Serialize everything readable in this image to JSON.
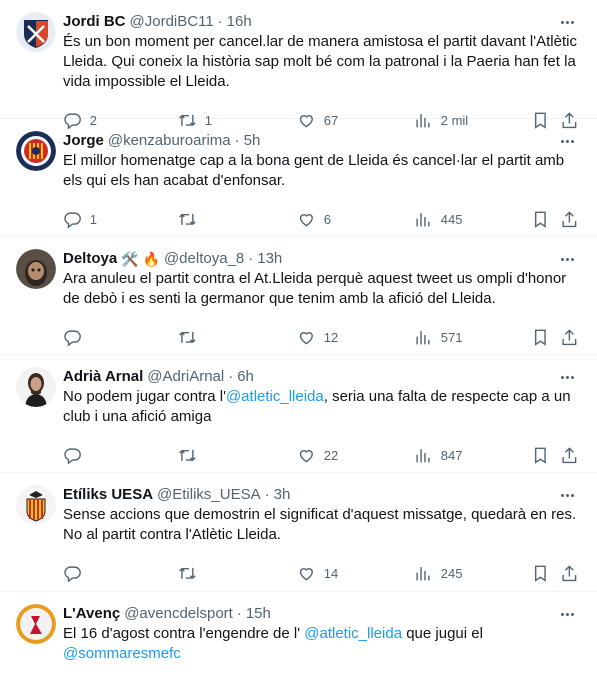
{
  "tweets": [
    {
      "name": "Jordi BC",
      "emoji": "",
      "handle": "@JordiBC11",
      "time": "16h",
      "text_parts": [
        {
          "t": "És un bon moment per cancel.lar de manera amistosa el partit davant l'Atlètic Lleida. Qui coneix la història sap molt bé com la patronal i la Paeria han fet la vida impossible el Lleida.",
          "m": false
        }
      ],
      "replies": "2",
      "retweets": "1",
      "likes": "67",
      "views": "2 mil"
    },
    {
      "name": "Jorge",
      "emoji": "",
      "handle": "@kenzaburoarima",
      "time": "5h",
      "text_parts": [
        {
          "t": "El millor homenatge cap a la bona gent de Lleida és cancel·lar el partit amb els qui els han acabat d'enfonsar.",
          "m": false
        }
      ],
      "replies": "1",
      "retweets": "",
      "likes": "6",
      "views": "445"
    },
    {
      "name": "Deltoya",
      "emoji": "🛠️ 🔥",
      "handle": "@deltoya_8",
      "time": "13h",
      "text_parts": [
        {
          "t": "Ara anuleu el partit contra el At.Lleida perquè aquest tweet us ompli d'honor de debò i es senti la germanor que tenim amb la afició del Lleida.",
          "m": false
        }
      ],
      "replies": "",
      "retweets": "",
      "likes": "12",
      "views": "571"
    },
    {
      "name": "Adrià Arnal",
      "emoji": "",
      "handle": "@AdriArnal",
      "time": "6h",
      "text_parts": [
        {
          "t": "No podem jugar contra l'",
          "m": false
        },
        {
          "t": "@atletic_lleida",
          "m": true
        },
        {
          "t": ", seria una falta de respecte cap a un club i una afició amiga",
          "m": false
        }
      ],
      "replies": "",
      "retweets": "",
      "likes": "22",
      "views": "847"
    },
    {
      "name": "Etíliks UESA",
      "emoji": "",
      "handle": "@Etiliks_UESA",
      "time": "3h",
      "text_parts": [
        {
          "t": "Sense accions que demostrin el significat d'aquest missatge, quedarà en res. No al partit contra l'Atlètic Lleida.",
          "m": false
        }
      ],
      "replies": "",
      "retweets": "",
      "likes": "14",
      "views": "245"
    },
    {
      "name": "L'Avenç",
      "emoji": "",
      "handle": "@avencdelsport",
      "time": "15h",
      "text_parts": [
        {
          "t": "El 16 d'agost contra l'engendre de l' ",
          "m": false
        },
        {
          "t": "@atletic_lleida",
          "m": true
        },
        {
          "t": " que jugui el ",
          "m": false
        },
        {
          "t": "@sommaresmefc",
          "m": true
        }
      ],
      "replies": "",
      "retweets": "",
      "likes": "",
      "views": ""
    }
  ],
  "icons": {
    "reply": "reply-icon",
    "retweet": "retweet-icon",
    "like": "heart-icon",
    "views": "views-icon",
    "bookmark": "bookmark-icon",
    "share": "share-icon",
    "more": "more-icon"
  },
  "colors": {
    "text": "#0f1419",
    "secondary": "#536471",
    "link": "#1d9bf0",
    "border": "#eff3f4"
  }
}
